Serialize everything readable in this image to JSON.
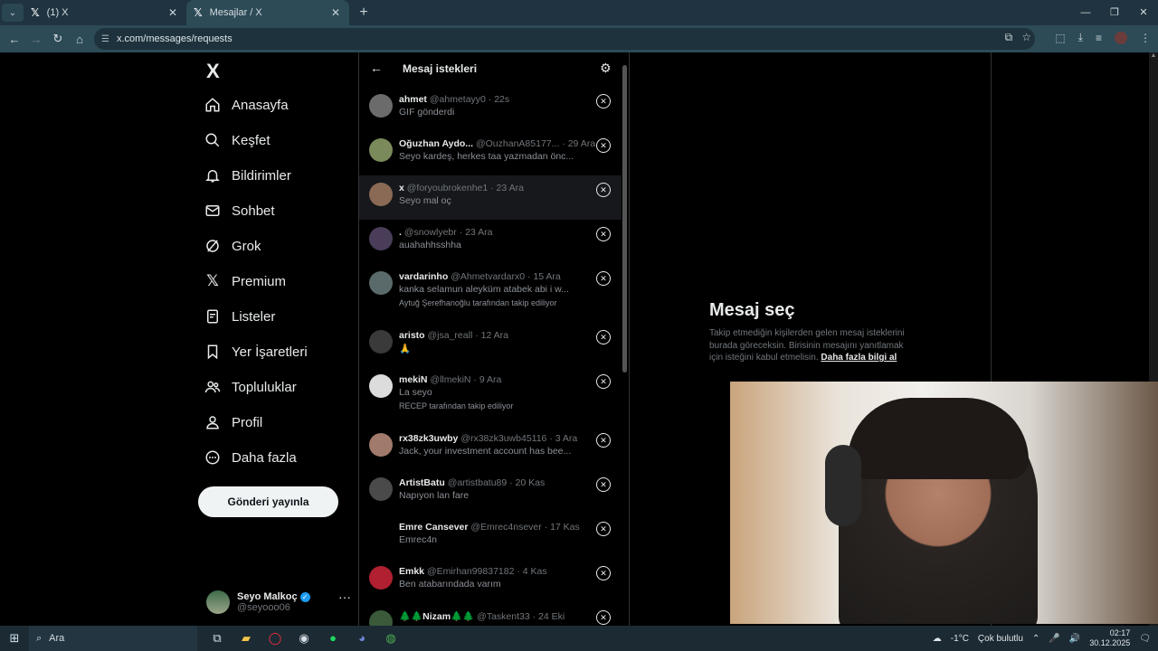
{
  "browser": {
    "tabs": [
      {
        "title": "(1) X",
        "active": false
      },
      {
        "title": "Mesajlar / X",
        "active": true
      }
    ],
    "url": "x.com/messages/requests"
  },
  "nav": {
    "logo": "X",
    "items": [
      {
        "label": "Anasayfa",
        "icon": "home-icon"
      },
      {
        "label": "Keşfet",
        "icon": "search-icon"
      },
      {
        "label": "Bildirimler",
        "icon": "bell-icon"
      },
      {
        "label": "Sohbet",
        "icon": "mail-icon"
      },
      {
        "label": "Grok",
        "icon": "grok-icon"
      },
      {
        "label": "Premium",
        "icon": "x-premium-icon"
      },
      {
        "label": "Listeler",
        "icon": "list-icon"
      },
      {
        "label": "Yer İşaretleri",
        "icon": "bookmark-icon"
      },
      {
        "label": "Topluluklar",
        "icon": "communities-icon"
      },
      {
        "label": "Profil",
        "icon": "person-icon"
      },
      {
        "label": "Daha fazla",
        "icon": "more-circle-icon"
      }
    ],
    "post_button": "Gönderi yayınla",
    "profile": {
      "name": "Seyo Malkoç",
      "handle": "@seyooo06",
      "verified_mark": "✓"
    }
  },
  "requests": {
    "title": "Mesaj istekleri",
    "items": [
      {
        "name": "ahmet",
        "handle": "@ahmetayy0 · 22s",
        "preview": "GIF gönderdi",
        "note": ""
      },
      {
        "name": "Oğuzhan Aydo...",
        "handle": "@OuzhanA85177... · 29 Ara",
        "preview": "Seyo kardeş, herkes taa yazmadan önc...",
        "note": ""
      },
      {
        "name": "x",
        "handle": "@foryoubrokenhe1 · 23 Ara",
        "preview": "Seyo mal oç",
        "note": ""
      },
      {
        "name": ".",
        "handle": "@snowlyebr · 23 Ara",
        "preview": "auahahhsshha",
        "note": ""
      },
      {
        "name": "vardarinho",
        "handle": "@Ahmetvardarx0 · 15 Ara",
        "preview": "kanka selamun aleyküm atabek abi i w...",
        "note": "Aytuğ Şerefhanoğlu tarafından takip ediliyor"
      },
      {
        "name": "aristo",
        "handle": "@jsa_reall · 12 Ara",
        "preview": "🙏",
        "note": ""
      },
      {
        "name": "mekiN",
        "handle": "@llmekiN · 9 Ara",
        "preview": "La seyo",
        "note": "RECEP tarafından takip ediliyor"
      },
      {
        "name": "rx38zk3uwby",
        "handle": "@rx38zk3uwb45116 · 3 Ara",
        "preview": "Jack, your investment account has bee...",
        "note": ""
      },
      {
        "name": "ArtistBatu",
        "handle": "@artistbatu89 · 20 Kas",
        "preview": "Napıyon lan fare",
        "note": ""
      },
      {
        "name": "Emre Cansever",
        "handle": "@Emrec4nsever · 17 Kas",
        "preview": "Emrec4n",
        "note": ""
      },
      {
        "name": "Emkk",
        "handle": "@Emirhan99837182 · 4 Kas",
        "preview": "Ben atabarındada varım",
        "note": ""
      },
      {
        "name": "🌲🌲Nizam🌲🌲",
        "handle": "@Taskent33 · 24 Eki",
        "preview": "",
        "note": ""
      }
    ]
  },
  "detail": {
    "title": "Mesaj seç",
    "description": "Takip etmediğin kişilerden gelen mesaj isteklerini burada göreceksin. Birisinin mesajını yanıtlamak için isteğini kabul etmelisin.",
    "link": "Daha fazla bilgi al"
  },
  "taskbar": {
    "search": "Ara",
    "weather": "-1°C",
    "weather_desc": "Çok bulutlu",
    "time": "02:17",
    "date": "30.12.2025"
  }
}
